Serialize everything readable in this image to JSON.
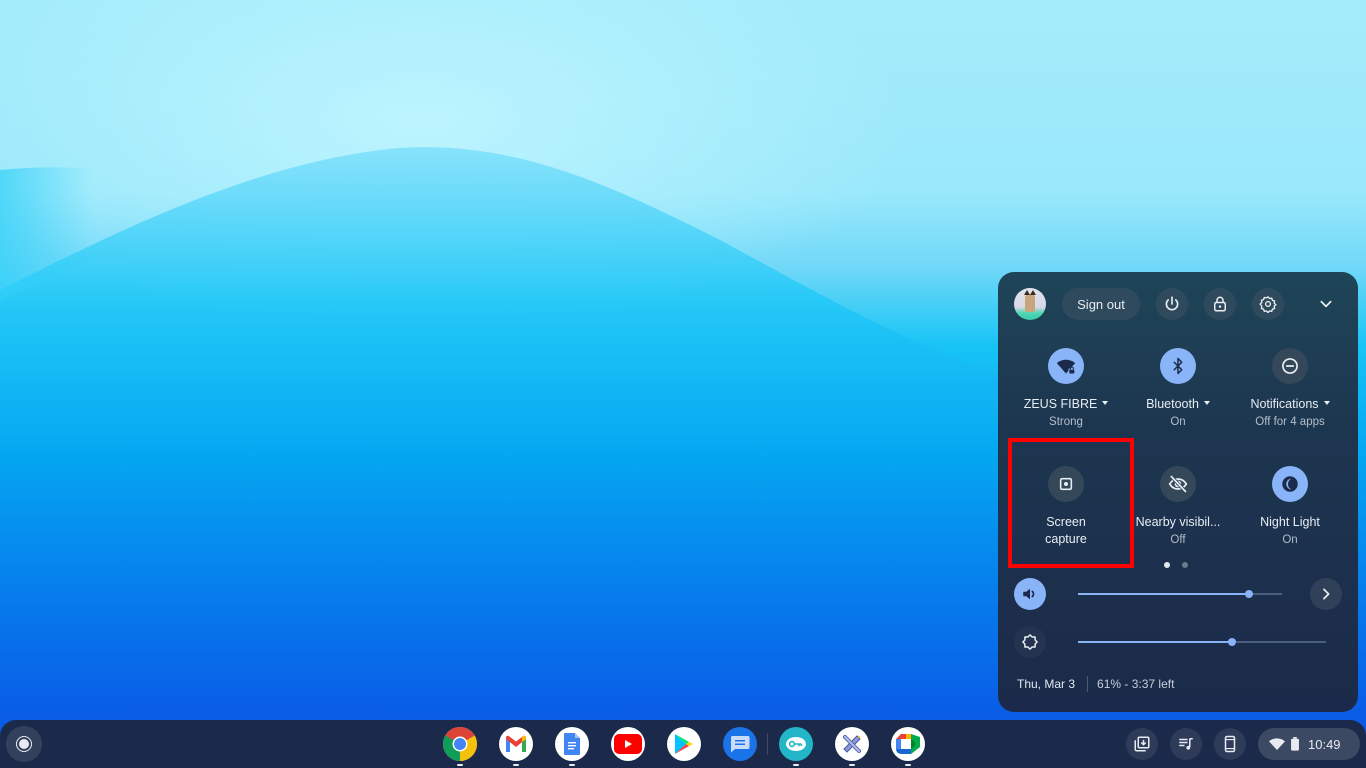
{
  "desktop": {
    "wallpaper": "blue-wave"
  },
  "quick_settings": {
    "top_row": {
      "avatar": "user-avatar",
      "sign_out_label": "Sign out",
      "buttons": [
        "power-icon",
        "lock-icon",
        "settings-icon"
      ],
      "collapse": "chevron-down-icon"
    },
    "tiles": [
      {
        "label": "ZEUS FIBRE",
        "sublabel": "Strong",
        "icon": "wifi-locked-icon",
        "active": true,
        "has_dropdown": true
      },
      {
        "label": "Bluetooth",
        "sublabel": "On",
        "icon": "bluetooth-icon",
        "active": true,
        "has_dropdown": true
      },
      {
        "label": "Notifications",
        "sublabel": "Off for 4 apps",
        "icon": "do-not-disturb-icon",
        "active": false,
        "has_dropdown": true
      },
      {
        "label": "Screen capture",
        "label_line1": "Screen",
        "label_line2": "capture",
        "icon": "screen-capture-icon",
        "active": false,
        "highlighted": true
      },
      {
        "label": "Nearby visibil...",
        "sublabel": "Off",
        "icon": "nearby-visibility-off-icon",
        "active": false
      },
      {
        "label": "Night Light",
        "sublabel": "On",
        "icon": "night-light-icon",
        "active": true
      }
    ],
    "pagination": {
      "pages": 2,
      "current": 1
    },
    "sliders": {
      "volume": {
        "icon": "volume-icon",
        "value": 0.84,
        "active": true
      },
      "brightness": {
        "icon": "brightness-icon",
        "value": 0.62,
        "active": false
      }
    },
    "audio_settings": "chevron-right-icon",
    "footer": {
      "date": "Thu, Mar 3",
      "battery": "61% - 3:37 left"
    }
  },
  "shelf": {
    "launcher": "launcher-icon",
    "apps": [
      {
        "name": "Chrome",
        "running": true
      },
      {
        "name": "Gmail",
        "running": true
      },
      {
        "name": "Docs",
        "running": true
      },
      {
        "name": "YouTube",
        "running": false
      },
      {
        "name": "Play Store",
        "running": false
      },
      {
        "name": "Messages",
        "running": false
      },
      {
        "name": "Password Manager",
        "running": true
      },
      {
        "name": "Drawing App",
        "running": true
      },
      {
        "name": "Google Meet",
        "running": true
      }
    ],
    "tray": {
      "holding_space": "holding-space-icon",
      "media_controls": "media-controls-icon",
      "phone_hub": "phone-hub-icon",
      "time": "10:49"
    }
  }
}
